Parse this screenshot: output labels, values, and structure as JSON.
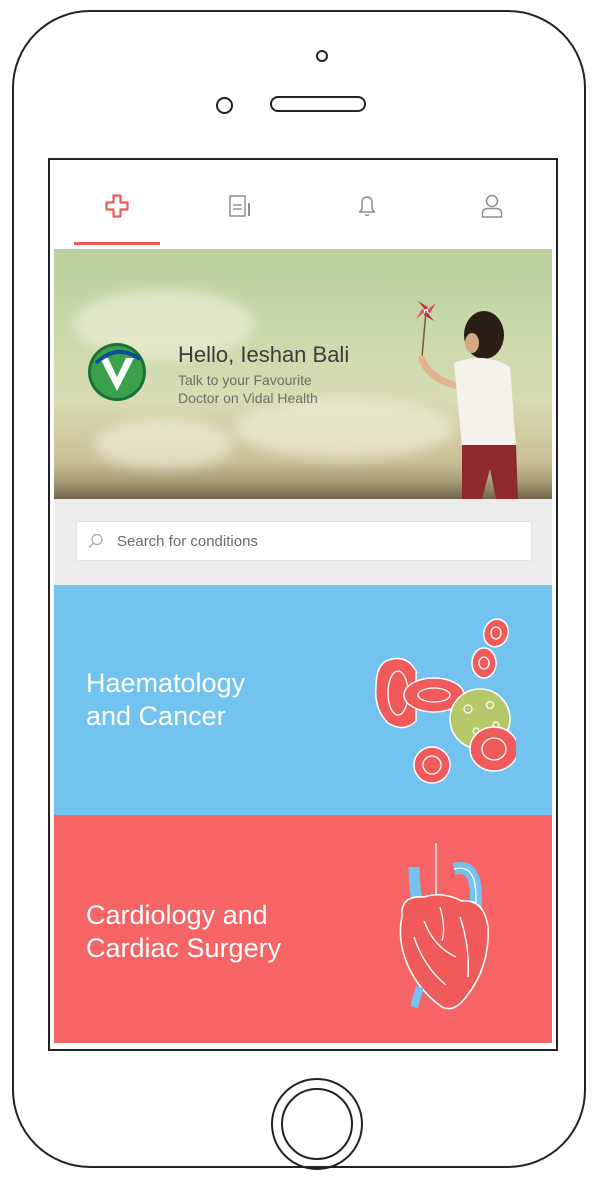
{
  "tabs": [
    {
      "name": "home",
      "icon": "medical-cross-icon",
      "active": true
    },
    {
      "name": "records",
      "icon": "clipboard-icon",
      "active": false
    },
    {
      "name": "notifications",
      "icon": "bell-icon",
      "active": false
    },
    {
      "name": "profile",
      "icon": "user-icon",
      "active": false
    }
  ],
  "hero": {
    "greeting": "Hello, Ieshan Bali",
    "subtitle_line1": "Talk to your Favourite",
    "subtitle_line2": "Doctor on Vidal Health"
  },
  "search": {
    "placeholder": "Search for conditions",
    "value": ""
  },
  "categories": [
    {
      "line1": "Haematology",
      "line2": "and Cancer",
      "color": "#73c3f0",
      "icon": "blood-cells-icon"
    },
    {
      "line1": "Cardiology and",
      "line2": "Cardiac Surgery",
      "color": "#f76465",
      "icon": "heart-organ-icon"
    }
  ],
  "colors": {
    "accent": "#ee5a5a",
    "haematology_bg": "#73c3f0",
    "cardiology_bg": "#f76465"
  }
}
